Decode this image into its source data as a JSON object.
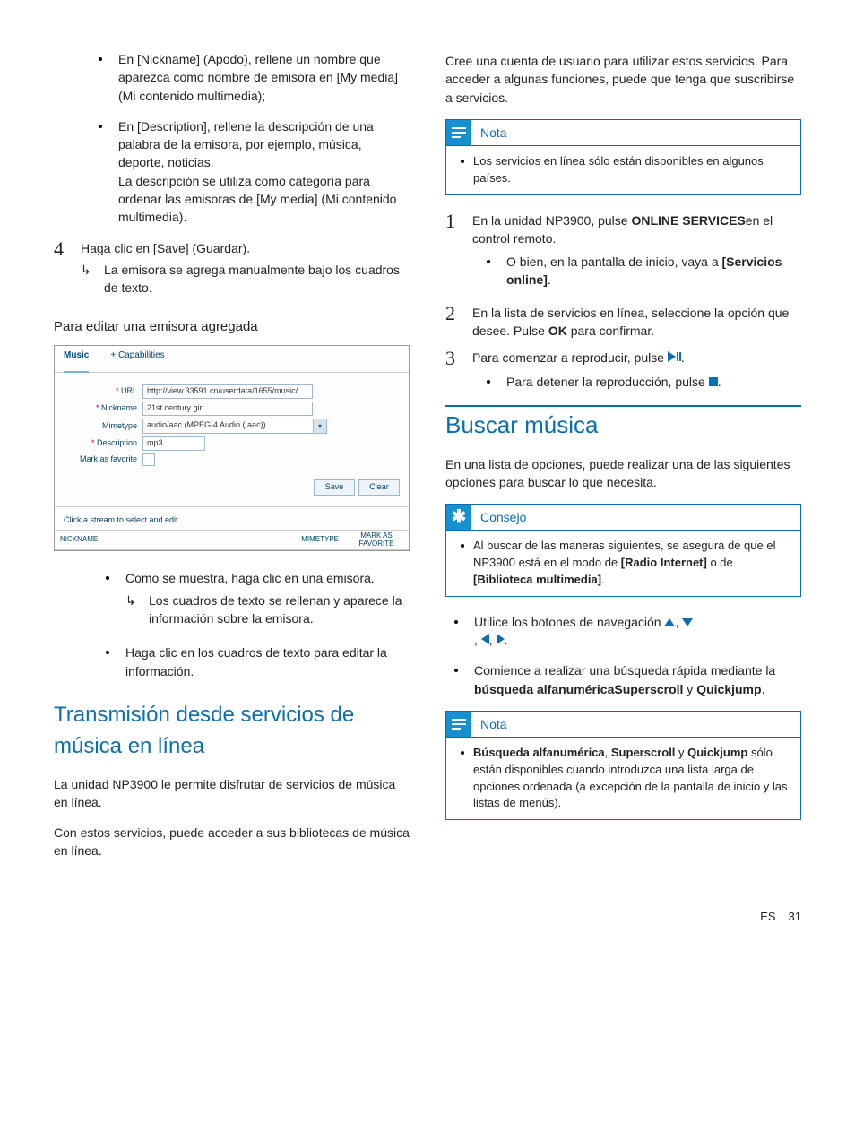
{
  "left": {
    "bullets": [
      "En [Nickname] (Apodo), rellene un nombre que aparezca como nombre de emisora en [My media] (Mi contenido multimedia);",
      "En [Description], rellene la descripción de una palabra de la emisora, por ejemplo, música, deporte, noticias.\nLa descripción se utiliza como categoría para ordenar las emisoras de [My media] (Mi contenido multimedia)."
    ],
    "step4": {
      "num": "4",
      "text": "Haga clic en [Save] (Guardar).",
      "sub": "La emisora se agrega manualmente bajo los cuadros de texto."
    },
    "edit_heading": "Para editar una emisora agregada",
    "mock": {
      "tabs": [
        "Music",
        "+  Capabilities"
      ],
      "url_label": "* URL",
      "url_value": "http://view.33591.cn/userdata/1655/music/",
      "nick_label": "* Nickname",
      "nick_value": "21st century girl",
      "mime_label": "Mimetype",
      "mime_value": "audio/aac (MPEG-4 Audio (.aac))",
      "desc_label": "* Description",
      "desc_value": "mp3",
      "fav_label": "Mark as favorite",
      "save": "Save",
      "clear": "Clear",
      "hint": "Click a stream to select and edit",
      "th_nick": "NICKNAME",
      "th_mime": "MIMETYPE",
      "th_fav": "MARK AS FAVORITE"
    },
    "after_mock": {
      "b1": "Como se muestra, haga clic en una emisora.",
      "b1sub": "Los cuadros de text se rellenan y aparece la información sobre la emisora.",
      "b1sub_real": "Los cuadros de texto se rellenan y aparece la información sobre la emisora.",
      "b2": "Haga clic en los cuadros de texto para editar la información."
    },
    "h_trans": "Transmisión desde servicios de música en línea",
    "p_trans1": "La unidad NP3900 le permite disfrutar de servicios de música en línea.",
    "p_trans2": "Con estos servicios, puede acceder a sus bibliotecas de música en línea."
  },
  "right": {
    "p_top": "Cree una cuenta de usuario para utilizar estos servicios. Para acceder a algunas funciones, puede que tenga que suscribirse a servicios.",
    "note1_title": "Nota",
    "note1_body": "Los servicios en línea sólo están disponibles en algunos países.",
    "step1": {
      "num": "1",
      "t1": "En la unidad NP3900, pulse ",
      "b1": "ONLINE SERVICES",
      "t2": "en el control remoto.",
      "sub_t": "O bien, en la pantalla de inicio, vaya a ",
      "sub_b": "[Servicios online]",
      "sub_t2": "."
    },
    "step2": {
      "num": "2",
      "t1": "En la lista de servicios en línea, seleccione la opción que desee. Pulse ",
      "b1": "OK",
      "t2": " para confirmar."
    },
    "step3": {
      "num": "3",
      "t1": "Para comenzar a reproducir, pulse ",
      "sub_t": "Para detener la reproducción, pulse "
    },
    "h_search": "Buscar música",
    "p_search": "En una lista de opciones, puede realizar una de las siguientes opciones para buscar lo que necesita.",
    "tip_title": "Consejo",
    "tip_body_pre": "Al buscar de las maneras siguientes, se asegura de que el NP3900 está en el modo de ",
    "tip_body_b1": "[Radio Internet]",
    "tip_body_mid": " o de ",
    "tip_body_b2": "[Biblioteca multimedia]",
    "tip_body_post": ".",
    "nav_bullet": "Utilice los botones de navegación ",
    "quick_t1": "Comience a realizar una búsqueda rápida mediante la ",
    "quick_b1": "búsqueda alfanumérica",
    "quick_b2": "Superscroll",
    "quick_mid": " y ",
    "quick_b3": "Quickjump",
    "quick_post": ".",
    "note2_title": "Nota",
    "note2_b1": "Búsqueda alfanumérica",
    "note2_b2": "Superscroll",
    "note2_b3": "Quickjump",
    "note2_rest": " sólo están disponibles cuando introduzca una lista larga de opciones ordenada (a excepción de la pantalla de inicio y las listas de menús)."
  },
  "footer": {
    "lang": "ES",
    "page": "31"
  }
}
